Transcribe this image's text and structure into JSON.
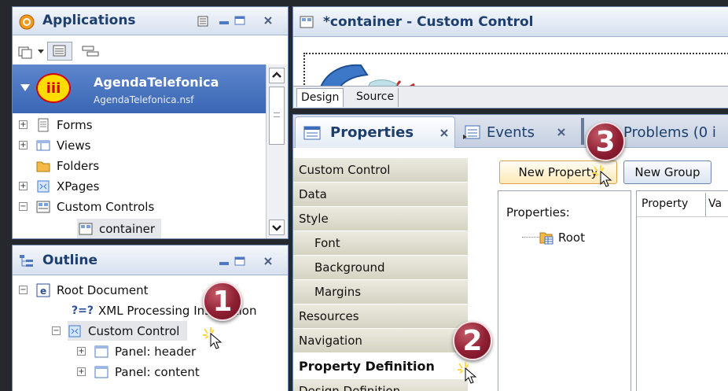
{
  "applications": {
    "title": "Applications",
    "app_name": "AgendaTelefonica",
    "app_file": "AgendaTelefonica.nsf",
    "tree": [
      "Forms",
      "Views",
      "Folders",
      "XPages",
      "Custom Controls",
      "container"
    ]
  },
  "outline": {
    "title": "Outline",
    "items": [
      "Root Document",
      "XML Processing Instruction",
      "Custom Control",
      "Panel: header",
      "Panel: content"
    ]
  },
  "editor": {
    "title": "*container - Custom Control",
    "tabs": [
      "Design",
      "Source"
    ]
  },
  "views": {
    "tabs": [
      "Properties",
      "Events",
      "Problems (0 i"
    ]
  },
  "nav": {
    "items": [
      "Custom Control",
      "Data",
      "Style",
      "Font",
      "Background",
      "Margins",
      "Resources",
      "Navigation",
      "Property Definition",
      "Design Definition"
    ]
  },
  "propdef": {
    "new_property": "New Property",
    "new_group": "New Group",
    "properties_label": "Properties:",
    "root": "Root",
    "columns": [
      "Property",
      "Va"
    ]
  },
  "callouts": [
    "1",
    "2",
    "3"
  ],
  "colors": {
    "callout": "#8f1f33",
    "header_text": "#1d3f6e",
    "selection": "#3a66b4"
  }
}
